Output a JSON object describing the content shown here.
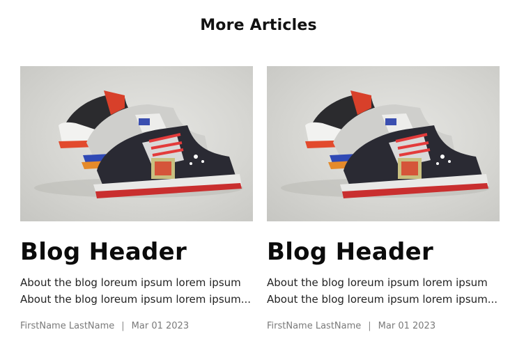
{
  "section": {
    "title": "More Articles"
  },
  "articles": [
    {
      "image_alt": "sneakers-photo",
      "title": "Blog Header",
      "description_lines": [
        "About the blog loreum ipsum lorem ipsum",
        "About the blog loreum ipsum lorem ipsum..."
      ],
      "author": "FirstName LastName",
      "separator": "|",
      "date": "Mar 01 2023"
    },
    {
      "image_alt": "sneakers-photo",
      "title": "Blog Header",
      "description_lines": [
        "About the blog loreum ipsum lorem ipsum",
        "About the blog loreum ipsum lorem ipsum..."
      ],
      "author": "FirstName LastName",
      "separator": "|",
      "date": "Mar 01 2023"
    }
  ]
}
